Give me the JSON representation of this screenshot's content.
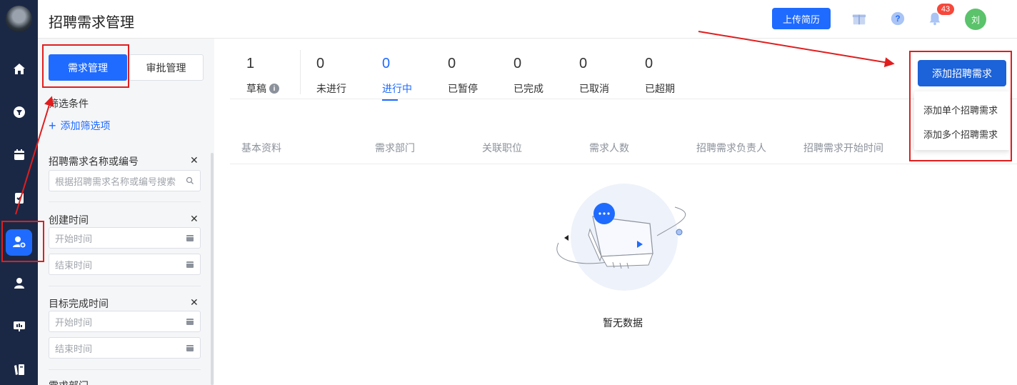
{
  "header": {
    "title": "招聘需求管理",
    "upload_label": "上传简历",
    "notification_count": "43",
    "user_initial": "刘"
  },
  "filter": {
    "tabs": [
      "需求管理",
      "审批管理"
    ],
    "title": "筛选条件",
    "add_label": "添加筛选项",
    "groups": [
      {
        "label": "招聘需求名称或编号",
        "fields": [
          "根据招聘需求名称或编号搜索"
        ]
      },
      {
        "label": "创建时间",
        "fields": [
          "开始时间",
          "结束时间"
        ]
      },
      {
        "label": "目标完成时间",
        "fields": [
          "开始时间",
          "结束时间"
        ]
      },
      {
        "label": "需求部门"
      }
    ]
  },
  "stats": [
    {
      "count": "1",
      "label": "草稿"
    },
    {
      "count": "0",
      "label": "未进行"
    },
    {
      "count": "0",
      "label": "进行中"
    },
    {
      "count": "0",
      "label": "已暂停"
    },
    {
      "count": "0",
      "label": "已完成"
    },
    {
      "count": "0",
      "label": "已取消"
    },
    {
      "count": "0",
      "label": "已超期"
    }
  ],
  "table": {
    "columns": [
      "基本资料",
      "需求部门",
      "关联职位",
      "需求人数",
      "招聘需求负责人",
      "招聘需求开始时间"
    ],
    "empty_text": "暂无数据"
  },
  "actions": {
    "add_label": "添加招聘需求",
    "menu": [
      "添加单个招聘需求",
      "添加多个招聘需求"
    ]
  },
  "colors": {
    "primary": "#1f6bff",
    "rail": "#1b2845",
    "annotation": "#e01e1e"
  }
}
